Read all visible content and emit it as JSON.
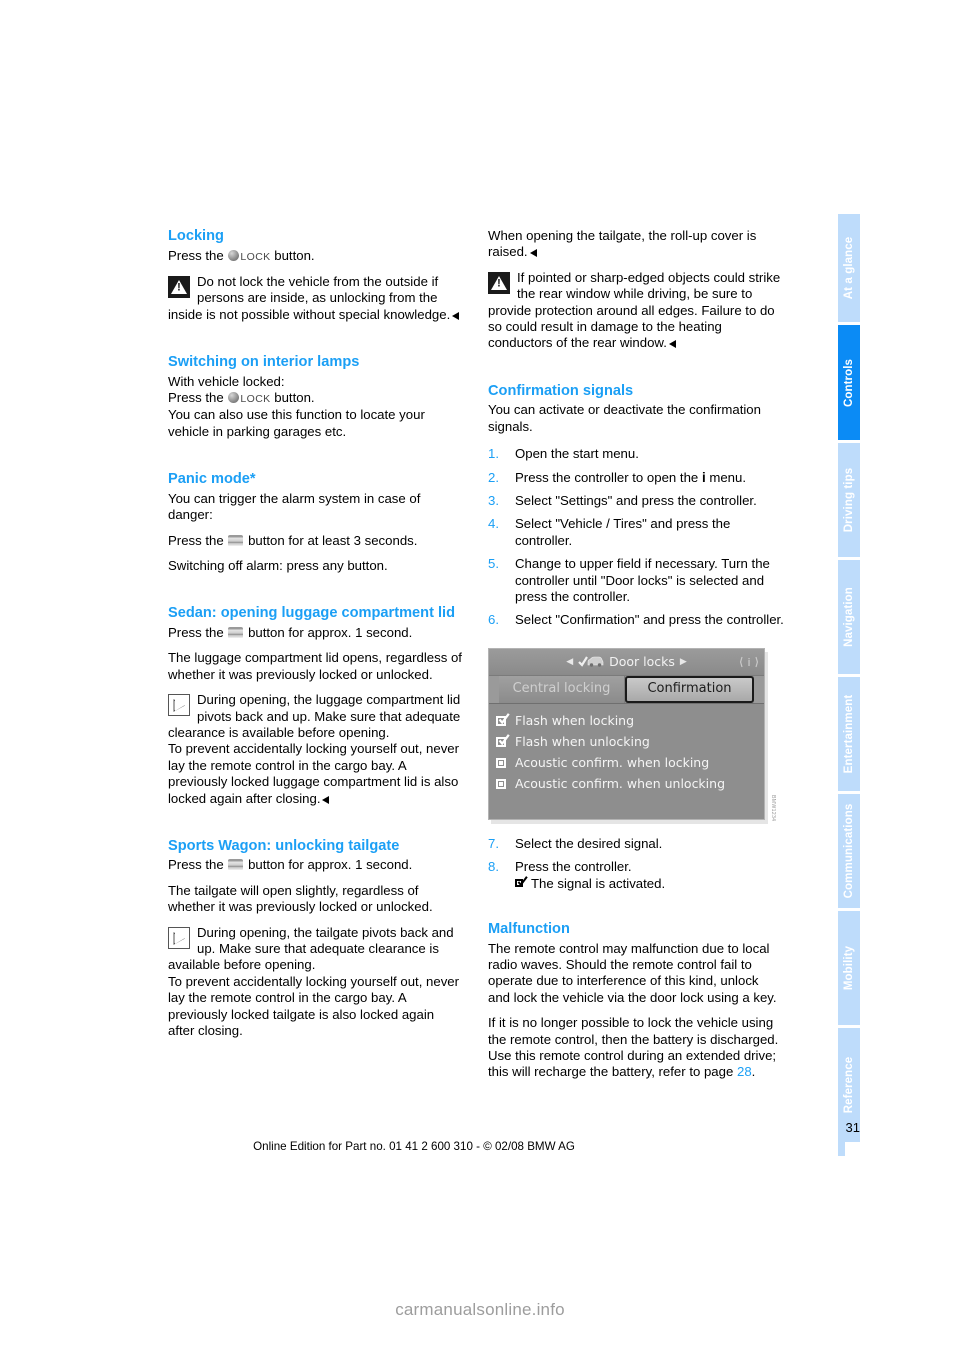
{
  "document": {
    "page_number": "31",
    "footer_text": "Online Edition for Part no. 01 41 2 600 310 - © 02/08 BMW AG",
    "watermark": "carmanualsonline.info"
  },
  "side_tabs": [
    {
      "label": "At a glance",
      "active": false
    },
    {
      "label": "Controls",
      "active": true
    },
    {
      "label": "Driving tips",
      "active": false
    },
    {
      "label": "Navigation",
      "active": false
    },
    {
      "label": "Entertainment",
      "active": false
    },
    {
      "label": "Communications",
      "active": false
    },
    {
      "label": "Mobility",
      "active": false
    },
    {
      "label": "Reference",
      "active": false
    }
  ],
  "left_column": {
    "locking": {
      "heading": "Locking",
      "press_prefix": "Press the",
      "lock_word": "LOCK",
      "press_suffix": "button.",
      "warning": "Do not lock the vehicle from the outside if persons are inside, as unlocking from the inside is not possible without special knowledge."
    },
    "interior_lamps": {
      "heading": "Switching on interior lamps",
      "line1": "With vehicle locked:",
      "press_prefix": "Press the",
      "lock_word": "LOCK",
      "press_suffix": "button.",
      "line3": "You can also use this function to locate your vehicle in parking garages etc."
    },
    "panic_mode": {
      "heading": "Panic mode*",
      "para1": "You can trigger the alarm system in case of danger:",
      "press_prefix": "Press the",
      "press_suffix": "button for at least 3 seconds.",
      "para3": "Switching off alarm: press any button."
    },
    "sedan": {
      "heading": "Sedan: opening luggage compartment lid",
      "press_prefix": "Press the",
      "press_suffix": "button for approx. 1 second.",
      "para2": "The luggage compartment lid opens, regardless of whether it was previously locked or unlocked.",
      "note": "During opening, the luggage compartment lid pivots back and up. Make sure that adequate clearance is available before opening.",
      "note_cont": "To prevent accidentally locking yourself out, never lay the remote control in the cargo bay. A previously locked luggage compartment lid is also locked again after closing."
    },
    "sports_wagon": {
      "heading": "Sports Wagon: unlocking tailgate",
      "press_prefix": "Press the",
      "press_suffix": "button for approx. 1 second.",
      "para2": "The tailgate will open slightly, regardless of whether it was previously locked or unlocked.",
      "note": "During opening, the tailgate pivots back and up. Make sure that adequate clearance is available before opening.",
      "note_cont": "To prevent accidentally locking yourself out, never lay the remote control in the cargo bay. A previously locked tailgate is also locked again after closing."
    }
  },
  "right_column": {
    "rollup": {
      "para": "When opening the tailgate, the roll-up cover is raised."
    },
    "warning": {
      "text": "If pointed or sharp-edged objects could strike the rear window while driving, be sure to provide protection around all edges. Failure to do so could result in damage to the heating conductors of the rear window."
    },
    "confirmation_signals": {
      "heading": "Confirmation signals",
      "intro": "You can activate or deactivate the confirmation signals.",
      "steps": [
        {
          "num": "1.",
          "text": "Open the start menu."
        },
        {
          "num": "2.",
          "text_before": "Press the controller to open the",
          "icon": "i",
          "text_after": "menu."
        },
        {
          "num": "3.",
          "text": "Select \"Settings\" and press the controller."
        },
        {
          "num": "4.",
          "text": "Select \"Vehicle / Tires\" and press the controller."
        },
        {
          "num": "5.",
          "text": "Change to upper field if necessary. Turn the controller until \"Door locks\" is selected and press the controller."
        },
        {
          "num": "6.",
          "text": "Select \"Confirmation\" and press the controller."
        }
      ],
      "steps_after": [
        {
          "num": "7.",
          "text": "Select the desired signal."
        },
        {
          "num": "8.",
          "text": "Press the controller."
        }
      ],
      "activated_note": "The signal is activated."
    },
    "idrive_screen": {
      "title": "Door locks",
      "tabs": [
        {
          "label": "Central locking",
          "selected": false
        },
        {
          "label": "Confirmation",
          "selected": true
        }
      ],
      "options": [
        {
          "label": "Flash when locking",
          "checked": true
        },
        {
          "label": "Flash when unlocking",
          "checked": true
        },
        {
          "label": "Acoustic confirm. when locking",
          "checked": false
        },
        {
          "label": "Acoustic confirm. when unlocking",
          "checked": false
        }
      ],
      "caption": "BMW1234"
    },
    "malfunction": {
      "heading": "Malfunction",
      "para1": "The remote control may malfunction due to local radio waves. Should the remote control fail to operate due to interference of this kind, unlock and lock the vehicle via the door lock using a key.",
      "para2_before": "If it is no longer possible to lock the vehicle using the remote control, then the battery is discharged. Use this remote control during an extended drive; this will recharge the battery, refer to page",
      "page_ref": "28",
      "para2_after": "."
    }
  },
  "colors": {
    "accent_blue": "#1b9ff5",
    "tab_inactive": "#bedcfb",
    "tab_active": "#0b8bf5"
  }
}
